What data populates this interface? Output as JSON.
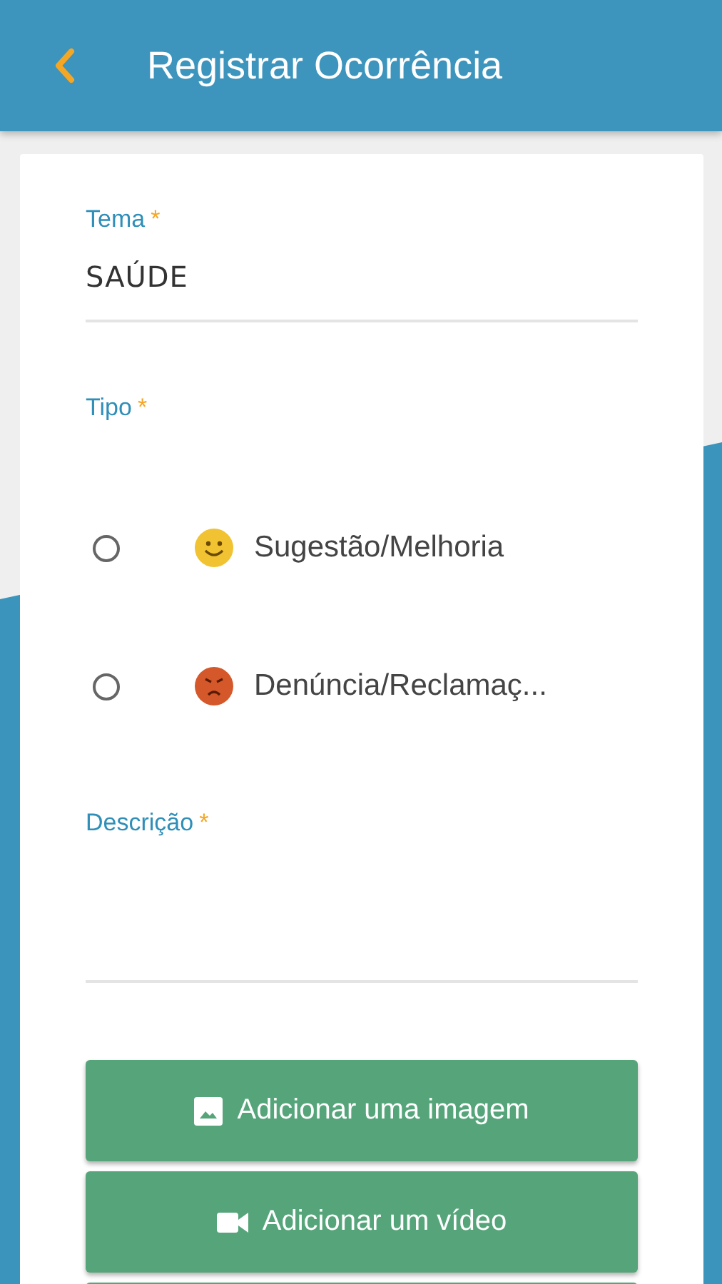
{
  "header": {
    "title": "Registrar Ocorrência"
  },
  "tema": {
    "label": "Tema",
    "mark": "*",
    "value": "SAÚDE"
  },
  "tipo": {
    "label": "Tipo",
    "mark": "*",
    "options": [
      {
        "label": "Sugestão/Melhoria",
        "kind": "happy",
        "selected": false
      },
      {
        "label": "Denúncia/Reclamaç...",
        "kind": "angry",
        "selected": false
      }
    ]
  },
  "descricao": {
    "label": "Descrição",
    "mark": "*"
  },
  "buttons": [
    {
      "label": "Adicionar uma imagem",
      "kind": "image"
    },
    {
      "label": "Adicionar um vídeo",
      "kind": "video"
    }
  ],
  "more_buttons_below": true
}
